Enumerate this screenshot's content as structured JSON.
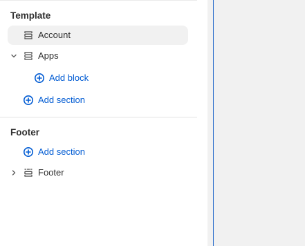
{
  "sidebar": {
    "template_heading": "Template",
    "footer_heading": "Footer",
    "items": {
      "account": {
        "label": "Account",
        "icon": "section-icon",
        "selected": true
      },
      "apps": {
        "label": "Apps",
        "icon": "section-icon",
        "expanded": true
      },
      "add_block": {
        "label": "Add block",
        "icon": "plus-circle-icon"
      },
      "add_section_template": {
        "label": "Add section",
        "icon": "plus-circle-icon"
      },
      "add_section_footer": {
        "label": "Add section",
        "icon": "plus-circle-icon"
      },
      "footer": {
        "label": "Footer",
        "icon": "section-dashed-icon",
        "expanded": false
      }
    }
  },
  "colors": {
    "link": "#005bd3",
    "text": "#303030",
    "selected_bg": "#f1f1f1",
    "canvas_bg": "#f1f1f1",
    "canvas_border": "#2c6ecb"
  }
}
